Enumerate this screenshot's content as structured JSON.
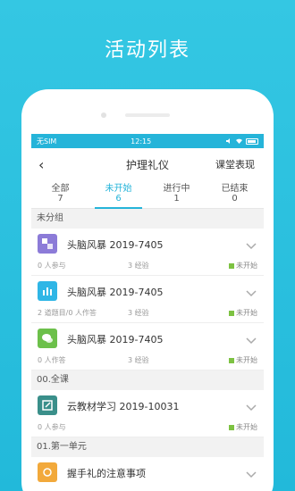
{
  "banner_title": "活动列表",
  "status_bar": {
    "carrier": "无SIM",
    "time": "12:15"
  },
  "nav": {
    "back": "‹",
    "title": "护理礼仪",
    "right": "课堂表现"
  },
  "tabs": [
    {
      "label": "全部",
      "count": "7"
    },
    {
      "label": "未开始",
      "count": "6"
    },
    {
      "label": "进行中",
      "count": "1"
    },
    {
      "label": "已结束",
      "count": "0"
    }
  ],
  "groups": [
    {
      "title": "未分组",
      "items": [
        {
          "icon": "brainstorm-icon",
          "icon_color": "#8c7bd8",
          "title": "头脑风暴 2019-7405",
          "meta": "0 人参与",
          "exp": "3 经验",
          "status": "未开始"
        },
        {
          "icon": "chart-icon",
          "icon_color": "#2fb6e6",
          "title": "头脑风暴 2019-7405",
          "meta": "2 道题目/0 人作答",
          "exp": "3 经验",
          "status": "未开始"
        },
        {
          "icon": "chat-icon",
          "icon_color": "#6cc04a",
          "title": "头脑风暴 2019-7405",
          "meta": "0 人作答",
          "exp": "3 经验",
          "status": "未开始"
        }
      ]
    },
    {
      "title": "00.全课",
      "items": [
        {
          "icon": "textbook-icon",
          "icon_color": "#3a8f8a",
          "title": "云教材学习 2019-10031",
          "meta": "0 人参与",
          "exp": "",
          "status": "未开始"
        }
      ]
    },
    {
      "title": "01.第一单元",
      "items": [
        {
          "icon": "resource-icon",
          "icon_color": "#f2a93b",
          "title": "握手礼的注意事项",
          "meta": "",
          "exp": "",
          "status": ""
        }
      ]
    }
  ]
}
